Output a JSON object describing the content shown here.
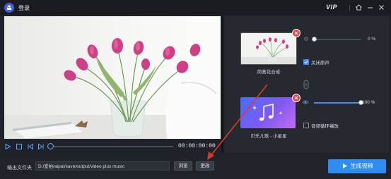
{
  "titlebar": {
    "title": "登录",
    "vip": "VIP",
    "icons": [
      "app-logo-icon",
      "home-icon",
      "minimize-icon",
      "close-icon"
    ]
  },
  "player": {
    "timecode": "00:00:00:00",
    "progress": 0,
    "controls": [
      "play-icon",
      "stop-icon",
      "previous-icon",
      "next-icon"
    ]
  },
  "tracks": {
    "card1": {
      "caption": "茼蒿花合成",
      "volume_label": "0 %",
      "volume": 0,
      "mute_label": "关闭原声",
      "mute_checked": true
    },
    "card2": {
      "caption": "贝乐儿歌 - 小星星",
      "volume_label": "100 %",
      "volume": 100,
      "loop_label": "音频循环播放",
      "loop_checked": false
    }
  },
  "output": {
    "label": "输出文件夹",
    "path": "D:/爱拍/aipai/save/output/video plus music",
    "browse_label": "浏览",
    "change_label": "更改"
  },
  "generate": {
    "label": "生成视频"
  },
  "colors": {
    "accent": "#2f8cf0",
    "remove": "#e8444b",
    "annotation_arrow": "#d93a2b"
  }
}
